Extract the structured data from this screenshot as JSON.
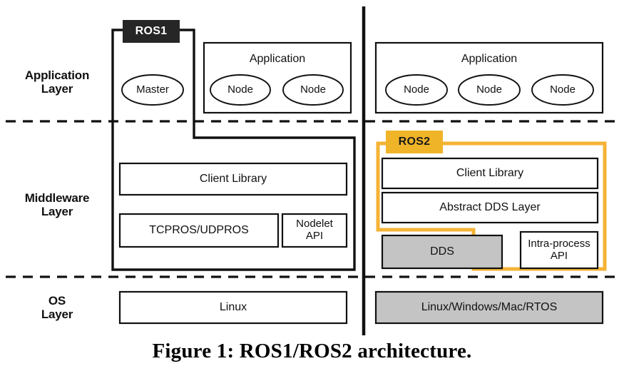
{
  "figure": {
    "caption": "Figure 1: ROS1/ROS2 architecture."
  },
  "layers": [
    {
      "name": "application-layer",
      "label": "Application\nLayer"
    },
    {
      "name": "middleware-layer",
      "label": "Middleware\nLayer"
    },
    {
      "name": "os-layer",
      "label": "OS\nLayer"
    }
  ],
  "tags": {
    "ros1": {
      "label": "ROS1",
      "bg": "#262626",
      "fg": "#FFFFFF"
    },
    "ros2": {
      "label": "ROS2",
      "bg": "#F0B428",
      "fg": "#1A1A1A"
    }
  },
  "colors": {
    "stroke": "#1A1A1A",
    "gray_fill": "#C4C4C4",
    "yellow": "#F5B335",
    "white": "#FFFFFF"
  },
  "ros1": {
    "application": {
      "master_label": "Master",
      "app_box_title": "Application",
      "nodes": [
        "Node",
        "Node"
      ]
    },
    "middleware": {
      "client_library": "Client Library",
      "transport": "TCPROS/UDPROS",
      "nodelet_api": "Nodelet\nAPI"
    },
    "os": {
      "os_box": "Linux"
    }
  },
  "ros2": {
    "application": {
      "app_box_title": "Application",
      "nodes": [
        "Node",
        "Node",
        "Node"
      ]
    },
    "middleware": {
      "client_library": "Client Library",
      "abstract_dds": "Abstract DDS Layer",
      "dds": "DDS",
      "intra_process_api": "Intra-process\nAPI"
    },
    "os": {
      "os_box": "Linux/Windows/Mac/RTOS"
    }
  }
}
